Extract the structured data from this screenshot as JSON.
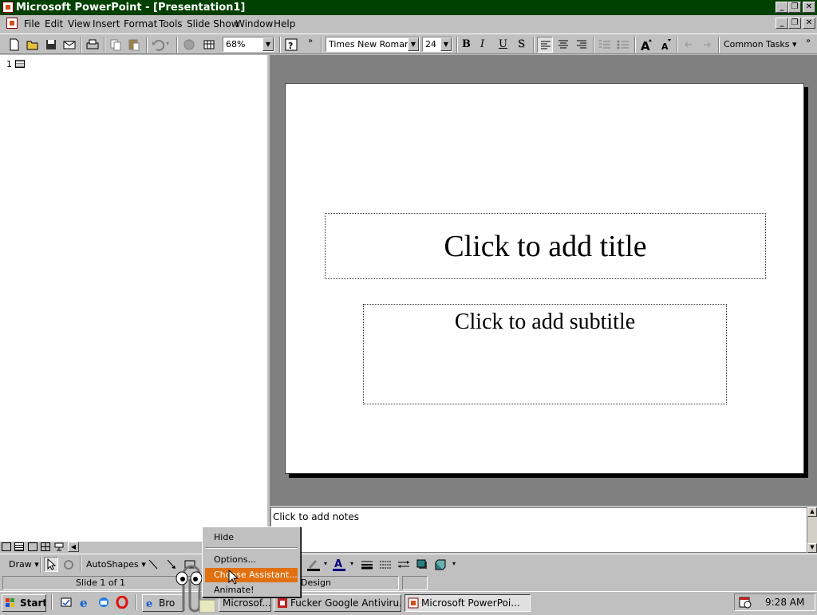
{
  "window": {
    "title": "Microsoft PowerPoint - [Presentation1]"
  },
  "menu": [
    "File",
    "Edit",
    "View",
    "Insert",
    "Format",
    "Tools",
    "Slide Show",
    "Window",
    "Help"
  ],
  "toolbar": {
    "zoom": "68%",
    "font": "Times New Roman",
    "font_size": "24",
    "bold": "B",
    "italic": "I",
    "underline": "U",
    "shadow": "S",
    "common_tasks": "Common Tasks"
  },
  "outline": {
    "slide_number": "1"
  },
  "slide": {
    "title_placeholder": "Click to add title",
    "subtitle_placeholder": "Click to add subtitle"
  },
  "notes": {
    "placeholder": "Click to add notes"
  },
  "drawing_toolbar": {
    "draw": "Draw",
    "autoshapes": "AutoShapes"
  },
  "statusbar": {
    "slide": "Slide 1 of 1",
    "design": "Design"
  },
  "assistant_menu": {
    "items": [
      "Hide",
      "Options...",
      "Choose Assistant...",
      "Animate!"
    ],
    "highlighted": "Choose Assistant..."
  },
  "taskbar": {
    "start": "Start",
    "tasks": [
      "Bro",
      "Microsof...",
      "Fucker Google Antiviru...",
      "Microsoft PowerPoi..."
    ],
    "active": "Microsoft PowerPoi...",
    "time": "9:28 AM"
  },
  "colors": {
    "title_bar": "#004000",
    "menu_highlight": "#e07010",
    "workspace": "#808080"
  },
  "icons": [
    "new-icon",
    "open-icon",
    "save-icon",
    "email-icon",
    "print-icon",
    "copy-icon",
    "paste-icon",
    "undo-icon",
    "hyperlink-icon",
    "table-icon",
    "help-icon",
    "align-left-icon",
    "align-center-icon",
    "align-right-icon",
    "numbering-icon",
    "bullets-icon",
    "increase-font-icon",
    "decrease-font-icon",
    "promote-icon",
    "demote-icon",
    "paperclip-assistant-icon"
  ]
}
